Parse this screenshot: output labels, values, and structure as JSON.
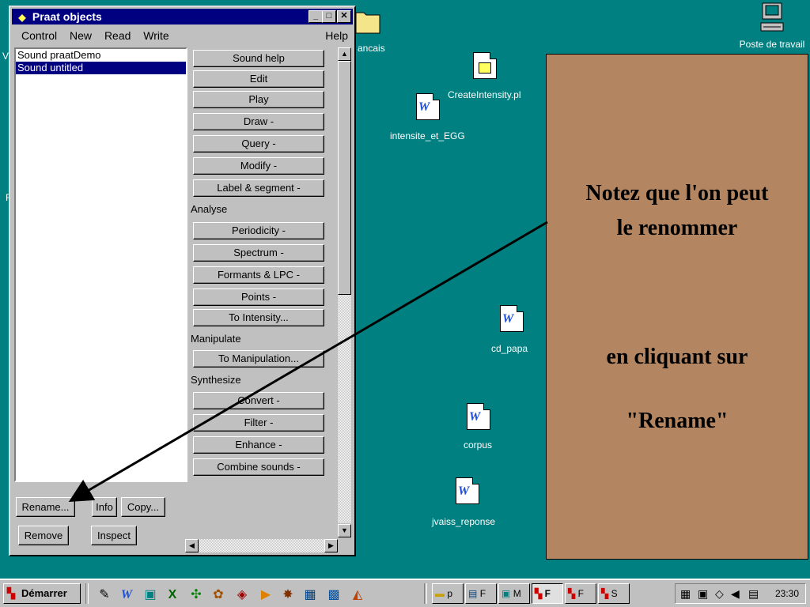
{
  "desktop": {
    "left_fragments": [
      "V",
      "F"
    ],
    "icons": {
      "poste": "Poste de travail",
      "francais": "ancais",
      "create_intensity": "CreateIntensity.pl",
      "intensite_egg": "intensite_et_EGG",
      "cd_papa": "cd_papa",
      "corpus": "corpus",
      "jvaiss": "jvaiss_reponse"
    }
  },
  "window": {
    "title": "Praat objects",
    "menu": [
      "Control",
      "New",
      "Read",
      "Write"
    ],
    "help": "Help",
    "controls": {
      "minimize": "_",
      "maximize": "□",
      "close": "✕"
    },
    "list": [
      "Sound praatDemo",
      "Sound untitled"
    ],
    "selected_index": 1,
    "commands": {
      "sound_help": "Sound help",
      "edit": "Edit",
      "play": "Play",
      "draw": "Draw -",
      "query": "Query -",
      "modify": "Modify -",
      "label_segment": "Label & segment -",
      "analyse": "Analyse",
      "periodicity": "Periodicity -",
      "spectrum": "Spectrum -",
      "formants": "Formants & LPC -",
      "points": "Points -",
      "to_intensity": "To Intensity...",
      "manipulate": "Manipulate",
      "to_manipulation": "To Manipulation...",
      "synthesize": "Synthesize",
      "convert": "Convert -",
      "filter": "Filter -",
      "enhance": "Enhance -",
      "combine": "Combine sounds -"
    },
    "bottom": {
      "rename": "Rename...",
      "info": "Info",
      "copy": "Copy...",
      "remove": "Remove",
      "inspect": "Inspect"
    }
  },
  "note": {
    "line1": "Notez que l'on peut",
    "line2": "le renommer",
    "line3": "en cliquant sur",
    "line4": "\"Rename\""
  },
  "taskbar": {
    "start": "Démarrer",
    "tasks": [
      "p",
      "F",
      "M",
      "F",
      "F",
      "S"
    ],
    "clock": "23:30"
  }
}
